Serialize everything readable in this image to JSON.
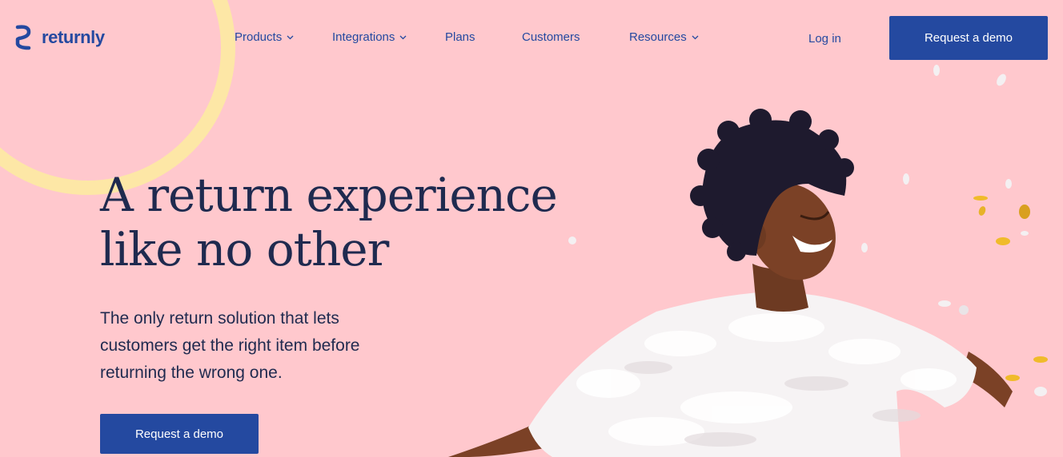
{
  "brand": {
    "name": "returnly",
    "color": "#2449a0"
  },
  "nav": {
    "items": [
      {
        "label": "Products",
        "has_dropdown": true
      },
      {
        "label": "Integrations",
        "has_dropdown": true
      },
      {
        "label": "Plans",
        "has_dropdown": false
      },
      {
        "label": "Customers",
        "has_dropdown": false
      },
      {
        "label": "Resources",
        "has_dropdown": true
      }
    ],
    "login_label": "Log in",
    "cta_label": "Request a demo"
  },
  "hero": {
    "headline_line1": "A return experience",
    "headline_line2": "like no other",
    "subtext_line1": "The only return solution that lets",
    "subtext_line2": "customers get the right item before",
    "subtext_line3": "returning the wrong one.",
    "cta_label": "Request a demo",
    "image_icon": "woman-celebrating-confetti-photo"
  },
  "colors": {
    "background": "#ffc8cd",
    "accent": "#2449a0",
    "ring": "#fde7a6",
    "text": "#1f2a4f"
  }
}
